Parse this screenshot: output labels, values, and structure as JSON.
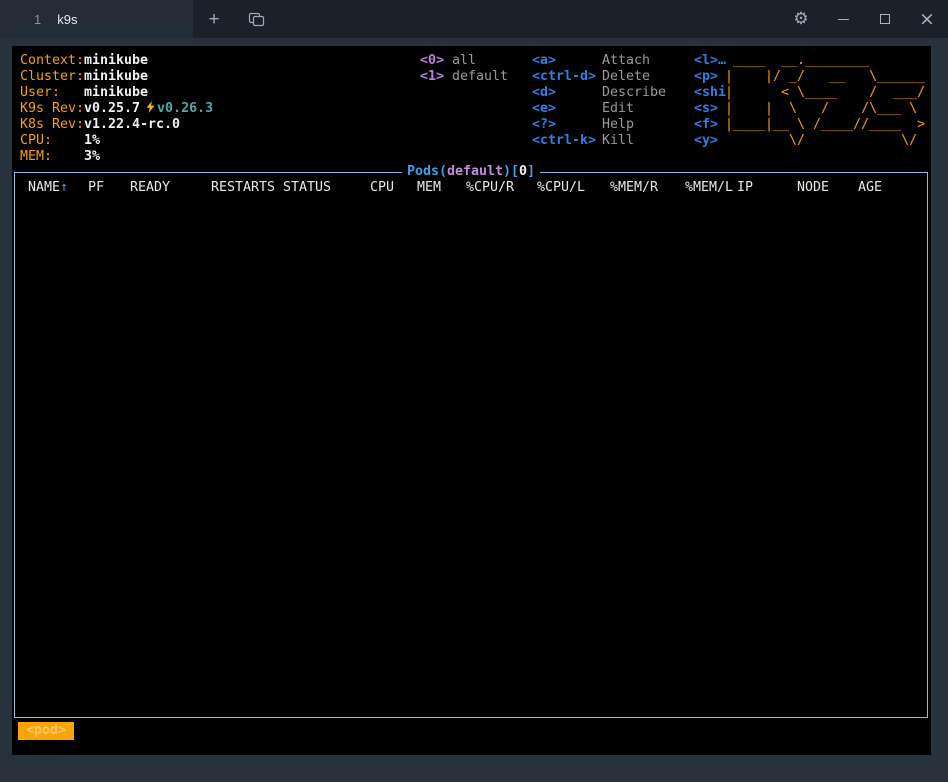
{
  "window": {
    "tab": {
      "index": "1",
      "title": "k9s"
    },
    "icons": {
      "new_tab": "plus-icon",
      "duplicate": "overlapping-squares-icon",
      "settings": "gear-icon",
      "minimize": "dash-icon",
      "maximize": "square-icon",
      "close": "x-icon"
    },
    "glyphs": {
      "plus": "+",
      "close": "×",
      "gear": "⚙"
    }
  },
  "header": {
    "info": [
      {
        "label": "Context:",
        "value": "minikube"
      },
      {
        "label": "Cluster:",
        "value": "minikube"
      },
      {
        "label": "User:",
        "value": "minikube"
      },
      {
        "label": "K9s Rev:",
        "value": "v0.25.7",
        "extra": "v0.26.3"
      },
      {
        "label": "K8s Rev:",
        "value": "v1.22.4-rc.0"
      },
      {
        "label": "CPU:",
        "value": "1%"
      },
      {
        "label": "MEM:",
        "value": "3%"
      }
    ],
    "namespace_keys": [
      {
        "key": "<0>",
        "label": "all"
      },
      {
        "key": "<1>",
        "label": "default"
      }
    ],
    "action_keys": [
      {
        "key": "<a>",
        "label": "Attach"
      },
      {
        "key": "<ctrl-d>",
        "label": "Delete"
      },
      {
        "key": "<d>",
        "label": "Describe"
      },
      {
        "key": "<e>",
        "label": "Edit"
      },
      {
        "key": "<?>",
        "label": "Help"
      },
      {
        "key": "<ctrl-k>",
        "label": "Kill"
      }
    ],
    "more_keys": [
      "<l>…",
      "<p>",
      "<shi",
      "<s>",
      "<f>",
      "<y>"
    ],
    "logo_lines": [
      " ____  __.________",
      "|    |/ _/   __   \\______",
      "|      < \\____    /  ___/",
      "|    |  \\   /    /\\___ \\ ",
      "|____|__ \\ /____//____  >",
      "        \\/            \\/ "
    ]
  },
  "view": {
    "title_resource": "Pods(",
    "title_namespace": "default",
    "title_mid": ")[",
    "title_count": "0",
    "title_end": "]"
  },
  "table": {
    "sort_arrow": "↑",
    "columns": [
      "NAME",
      "PF",
      "READY",
      "RESTARTS",
      "STATUS",
      "CPU",
      "MEM",
      "%CPU/R",
      "%CPU/L",
      "%MEM/R",
      "%MEM/L",
      "IP",
      "NODE",
      "AGE"
    ],
    "rows": []
  },
  "crumbs": {
    "items": [
      "<pod>"
    ]
  },
  "colors": {
    "label_orange": "#fb9f06",
    "value_white": "#f1f1f1",
    "upgrade_teal": "#4fa9ab",
    "bolt_yellow": "#fdb813",
    "key_blue": "#2e80e0",
    "hotkey_purple": "#b97fe0",
    "hint_gray": "#9a9a9a",
    "title_blue": "#41a0e6",
    "namespace_plum": "#c58ae2",
    "border_blue": "#8cbbe8",
    "crumb_bg": "#fba30a",
    "crumb_text": "#fdc863",
    "terminal_bg": "#000000",
    "chrome_bg": "#28323c",
    "tabbar_bg": "#19212b"
  }
}
